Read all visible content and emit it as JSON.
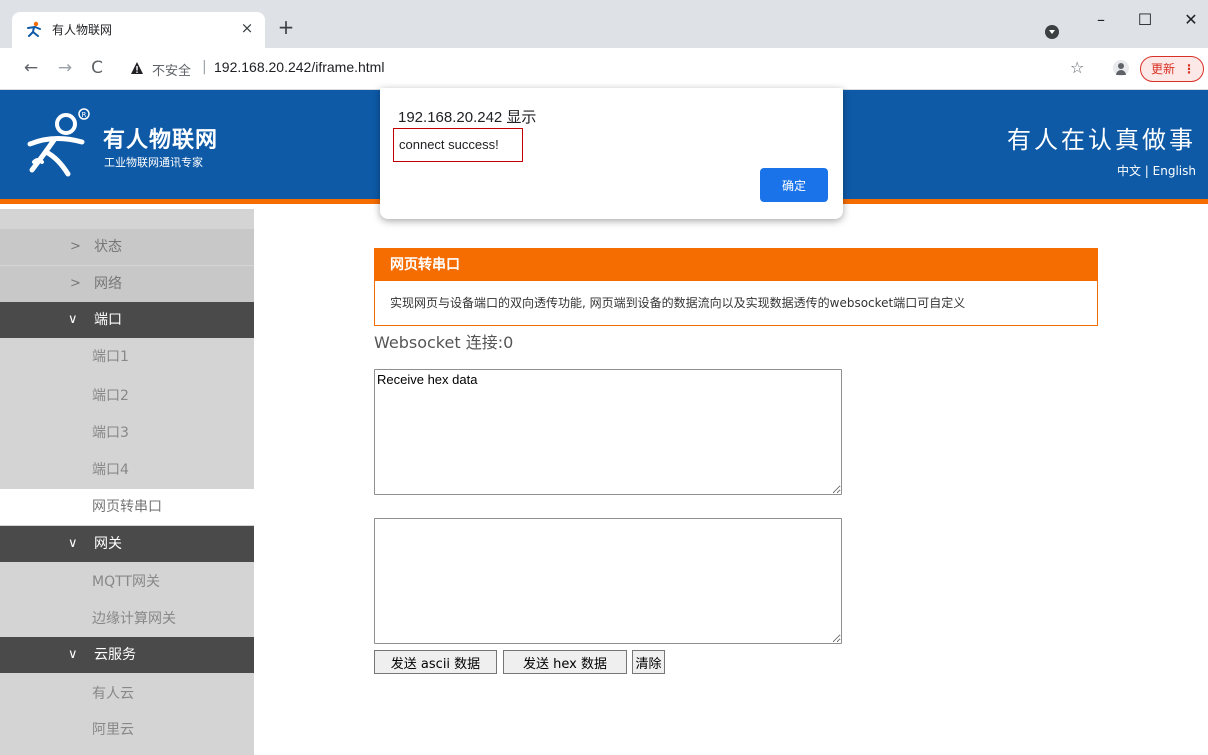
{
  "browser": {
    "tab_title": "有人物联网",
    "tab_close": "×",
    "new_tab": "+",
    "minimize": "–",
    "maximize": "☐",
    "close": "✕",
    "back": "←",
    "forward": "→",
    "reload": "C",
    "insecure_label": "不安全",
    "url_separator": "|",
    "url": "192.168.20.242/iframe.html",
    "star": "☆",
    "update_label": "更新",
    "menu_dots": "⋮"
  },
  "header": {
    "brand_name": "有人物联网",
    "brand_sub": "工业物联网通讯专家",
    "slogan": "有人在认真做事",
    "lang": "中文 | English"
  },
  "sidebar": {
    "items": [
      {
        "label": "状态"
      },
      {
        "label": "网络"
      },
      {
        "label": "端口"
      },
      {
        "label": "端口1"
      },
      {
        "label": "端口2"
      },
      {
        "label": "端口3"
      },
      {
        "label": "端口4"
      },
      {
        "label": "网页转串口"
      },
      {
        "label": "网关"
      },
      {
        "label": "MQTT网关"
      },
      {
        "label": "边缘计算网关"
      },
      {
        "label": "云服务"
      },
      {
        "label": "有人云"
      },
      {
        "label": "阿里云"
      }
    ],
    "chevron_right": ">",
    "chevron_down": "∨"
  },
  "panel": {
    "title": "网页转串口",
    "description": "实现网页与设备端口的双向透传功能, 网页端到设备的数据流向以及实现数据透传的websocket端口可自定义"
  },
  "websocket": {
    "status": "Websocket 连接:0"
  },
  "receive": {
    "value": "Receive hex data"
  },
  "buttons": {
    "send_ascii": "发送 ascii 数据",
    "send_hex": "发送 hex 数据",
    "clear": "清除"
  },
  "alert": {
    "title": "192.168.20.242 显示",
    "message": "connect success!",
    "ok": "确定"
  },
  "colors": {
    "header_blue": "#0e5aa7",
    "accent_orange": "#f56c00",
    "dialog_button": "#1a73e8"
  }
}
